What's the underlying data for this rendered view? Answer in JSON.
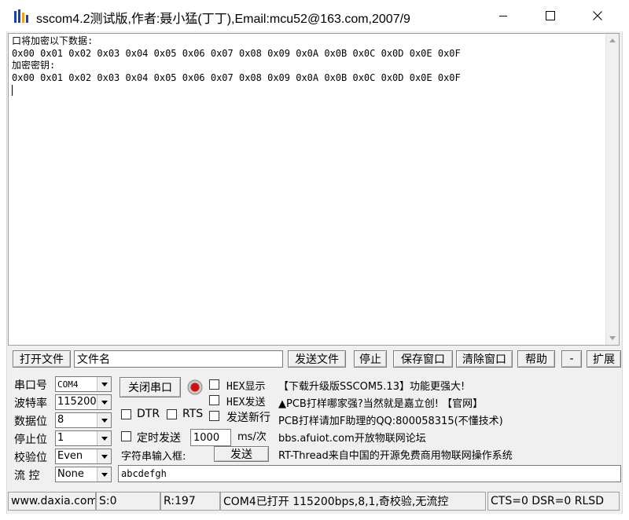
{
  "window": {
    "title": "sscom4.2测试版,作者:聂小猛(丁丁),Email:mcu52@163.com,2007/9"
  },
  "receive": {
    "lines": [
      "口将加密以下数据:",
      "0x00 0x01 0x02 0x03 0x04 0x05 0x06 0x07 0x08 0x09 0x0A 0x0B 0x0C 0x0D 0x0E 0x0F",
      "加密密钥:",
      "0x00 0x01 0x02 0x03 0x04 0x05 0x06 0x07 0x08 0x09 0x0A 0x0B 0x0C 0x0D 0x0E 0x0F"
    ]
  },
  "toolbar": {
    "open_file": "打开文件",
    "file_name_value": "文件名",
    "send_file": "发送文件",
    "stop": "停止",
    "save_window": "保存窗口",
    "clear_window": "清除窗口",
    "help": "帮助",
    "minus": "-",
    "expand": "扩展"
  },
  "port_settings": {
    "port_label": "串口号",
    "port_value": "COM4",
    "baud_label": "波特率",
    "baud_value": "115200",
    "data_bits_label": "数据位",
    "data_bits_value": "8",
    "stop_bits_label": "停止位",
    "stop_bits_value": "1",
    "parity_label": "校验位",
    "parity_value": "Even",
    "flow_label": "流 控",
    "flow_value": "None"
  },
  "controls": {
    "close_port": "关闭串口",
    "hex_display": "HEX显示",
    "hex_send": "HEX发送",
    "dtr": "DTR",
    "rts": "RTS",
    "send_newline": "发送新行",
    "timed_send": "定时发送",
    "interval_value": "1000",
    "interval_unit": "ms/次",
    "input_label": "字符串输入框:",
    "send": "发送",
    "input_value": "abcdefgh"
  },
  "info": {
    "line1": "【下载升级版SSCOM5.13】功能更强大!",
    "line2": "▲PCB打样哪家强?当然就是嘉立创! 【官网】",
    "line3": "PCB打样请加F助理的QQ:800058315(不懂技术)",
    "line4": "bbs.afuiot.com开放物联网论坛",
    "line5": "RT-Thread来自中国的开源免费商用物联网操作系统"
  },
  "status": {
    "website": "www.daxia.com",
    "sent": "S:0",
    "received": "R:197",
    "port_state": "COM4已打开  115200bps,8,1,奇校验,无流控",
    "signals": "CTS=0 DSR=0 RLSD"
  },
  "colors": {
    "led": "#d01010"
  }
}
